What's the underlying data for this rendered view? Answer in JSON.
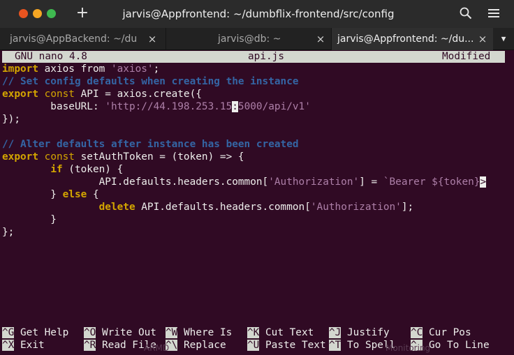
{
  "window": {
    "title": "jarvis@Appfrontend: ~/dumbflix-frontend/src/config",
    "colors": {
      "close": "#e95420",
      "minimize": "#f5a623",
      "maximize": "#3fb950",
      "terminal_bg": "#300a24"
    }
  },
  "tabs": [
    {
      "label": "jarvis@AppBackend: ~/du",
      "close": "×",
      "active": false
    },
    {
      "label": "jarvis@db: ~",
      "close": "×",
      "active": false
    },
    {
      "label": "jarvis@Appfrontend: ~/du...",
      "close": "×",
      "active": true
    }
  ],
  "nano": {
    "version": "GNU nano 4.8",
    "filename": "api.js",
    "status": "Modified"
  },
  "code": {
    "l1_kw": "import",
    "l1_mid": " axios from ",
    "l1_str": "'axios'",
    "l1_end": ";",
    "l2": "// Set config defaults when creating the instance",
    "l3_kw": "export",
    "l3_sp": " ",
    "l3_const": "const",
    "l3_rest": " API = axios.create({",
    "l4_pre": "        baseURL: ",
    "l4_str_a": "'http://44.198.253.15",
    "l4_cursor": ":",
    "l4_str_b": "5000/api/v1'",
    "l5": "});",
    "l7": "// Alter defaults after instance has been created",
    "l8_kw": "export",
    "l8_sp": " ",
    "l8_const": "const",
    "l8_rest": " setAuthToken = (token) => {",
    "l9_pre": "        ",
    "l9_kw": "if",
    "l9_rest": " (token) {",
    "l10_pre": "                API.defaults.headers.common[",
    "l10_str": "'Authorization'",
    "l10_mid": "] = ",
    "l10_str2": "`Bearer ${token}",
    "l10_more": ">",
    "l11_pre": "        } ",
    "l11_kw": "else",
    "l11_rest": " {",
    "l12_pre": "                ",
    "l12_kw": "delete",
    "l12_mid": " API.defaults.headers.common[",
    "l12_str": "'Authorization'",
    "l12_end": "];",
    "l13": "        }",
    "l14": "};"
  },
  "shortcuts": [
    {
      "key": "^G",
      "label": " Get Help"
    },
    {
      "key": "^O",
      "label": " Write Out"
    },
    {
      "key": "^W",
      "label": " Where Is"
    },
    {
      "key": "^K",
      "label": " Cut Text"
    },
    {
      "key": "^J",
      "label": " Justify"
    },
    {
      "key": "^C",
      "label": " Cur Pos"
    },
    {
      "key": "^X",
      "label": " Exit"
    },
    {
      "key": "^R",
      "label": " Read File"
    },
    {
      "key": "^\\",
      "label": " Replace"
    },
    {
      "key": "^U",
      "label": " Paste Text"
    },
    {
      "key": "^T",
      "label": " To Spell"
    },
    {
      "key": "^_",
      "label": " Go To Line"
    }
  ],
  "background_fragments": [
    "ARMD",
    "Monitoring"
  ],
  "icons": {
    "new_tab": "+",
    "search": "search-icon",
    "menu": "hamburger-menu-icon",
    "tab_dropdown": "▼"
  }
}
